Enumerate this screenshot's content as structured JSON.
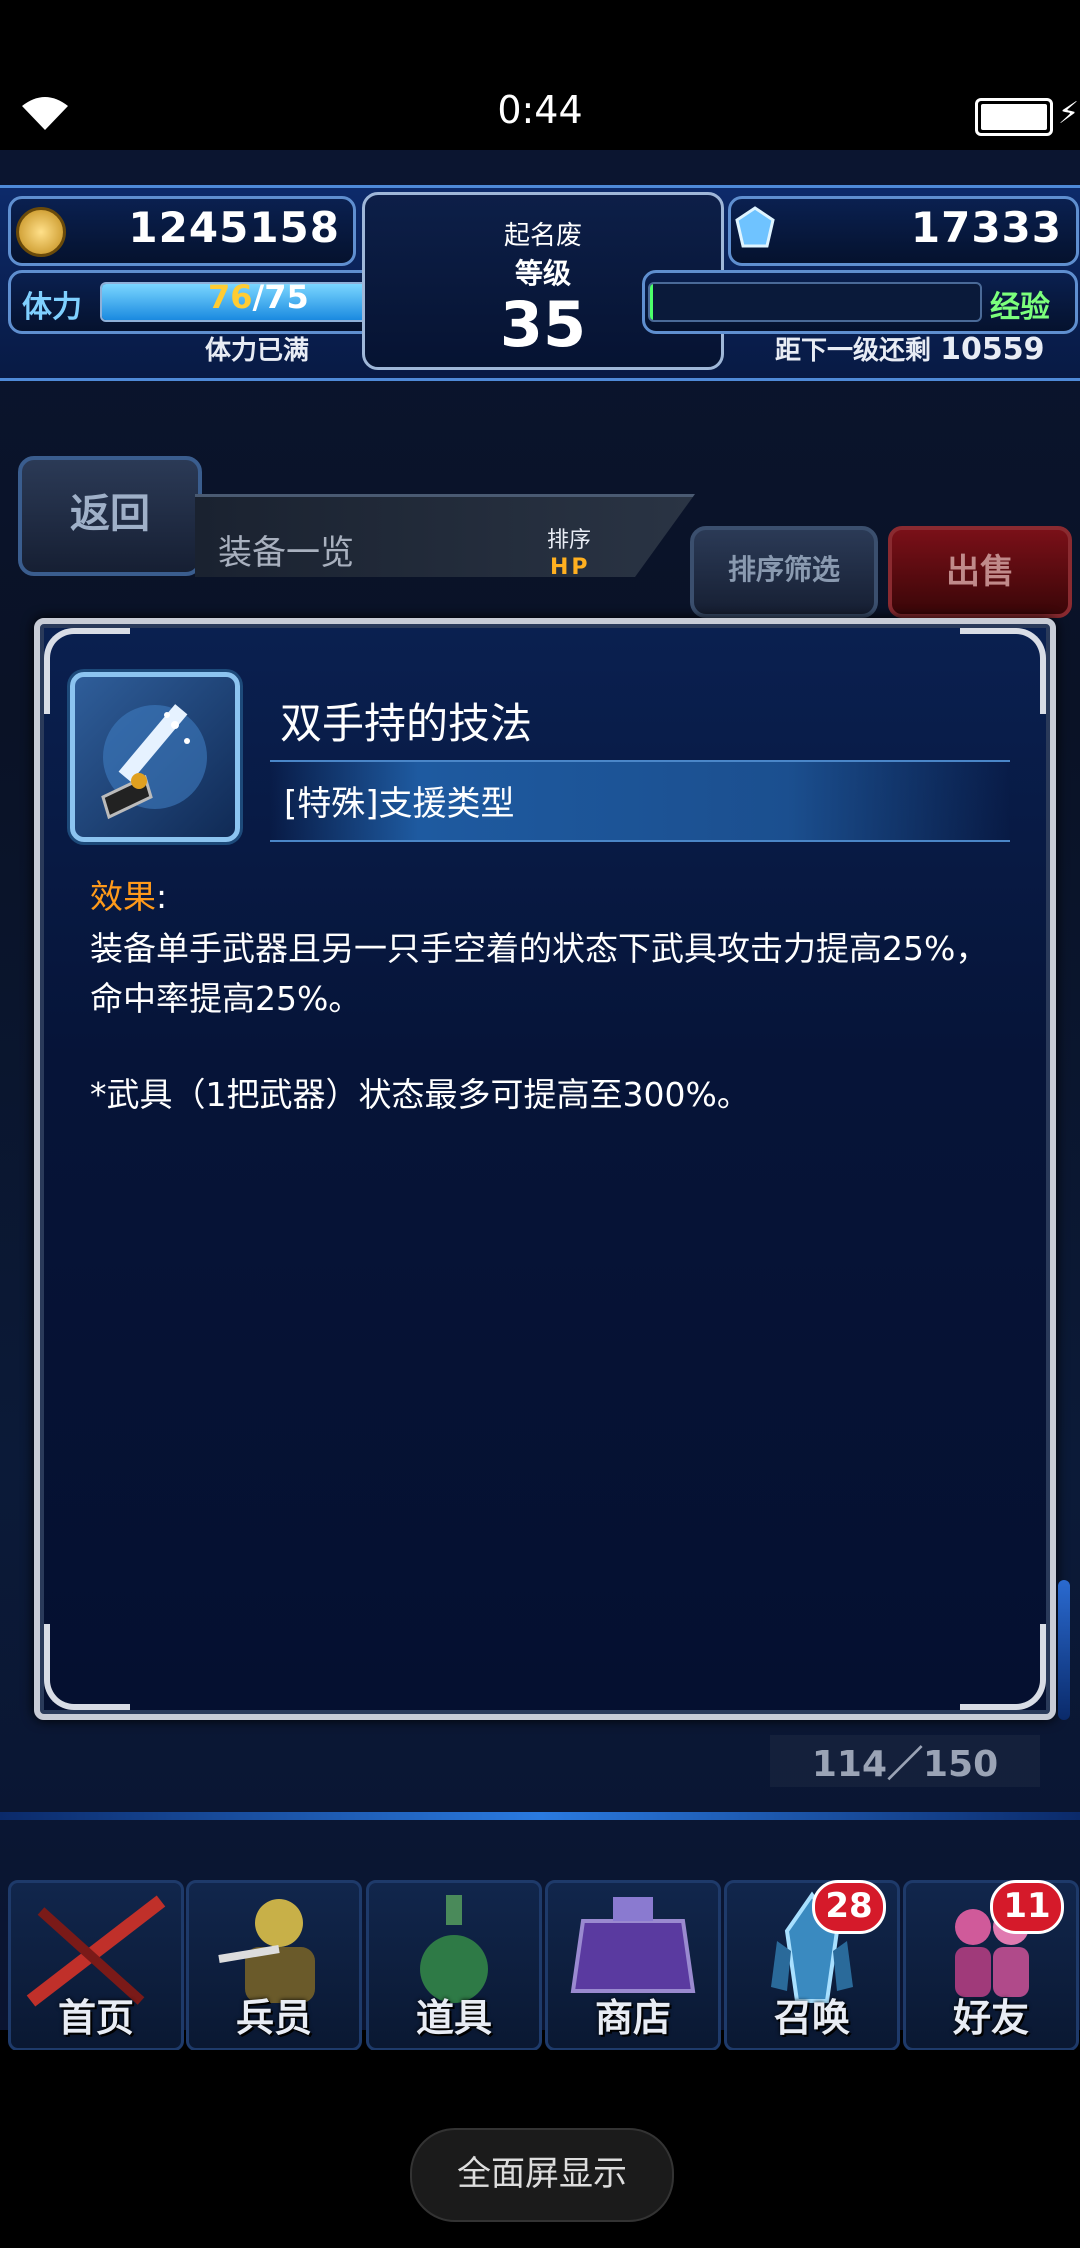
{
  "status": {
    "time": "0:44"
  },
  "hud": {
    "gil": "1245158",
    "player_name": "起名废",
    "level_label": "等级",
    "level": "35",
    "gems": "17333",
    "stamina_label": "体力",
    "stamina_current": "76",
    "stamina_max": "/75",
    "stamina_status": "体力已满",
    "exp_label": "经验",
    "exp_remaining_label": "距下一级还剩",
    "exp_remaining": "10559",
    "stamina_fill": 1.0,
    "exp_fill": 0.01
  },
  "nav": {
    "back_label": "返回",
    "section_title": "装备一览",
    "sort_label": "排序",
    "sort_value": "HP",
    "filter_label": "排序筛选",
    "sell_label": "出售"
  },
  "detail": {
    "name": "双手持的技法",
    "type": "[特殊]支援类型",
    "effect_label": "效果",
    "effect_colon": ":",
    "effect_line1": "装备单手武器且另一只手空着的状态下武具攻击力提高25%，",
    "effect_line2": "命中率提高25%。",
    "note": "*武具（1把武器）状态最多可提高至300%。"
  },
  "inventory": {
    "count": "114／150"
  },
  "tabs": [
    {
      "label": "首页",
      "icon": "sword-icon"
    },
    {
      "label": "兵员",
      "icon": "soldier-icon"
    },
    {
      "label": "道具",
      "icon": "potion-icon"
    },
    {
      "label": "商店",
      "icon": "shop-icon"
    },
    {
      "label": "召唤",
      "icon": "crystal-icon",
      "badge": "28"
    },
    {
      "label": "好友",
      "icon": "friends-icon",
      "badge": "11"
    }
  ],
  "system": {
    "fullscreen_label": "全面屏显示"
  },
  "colors": {
    "accent": "#4f8ad8",
    "effect": "#ff9a1a",
    "exp": "#7cff7c",
    "badge": "#d51a2a"
  }
}
